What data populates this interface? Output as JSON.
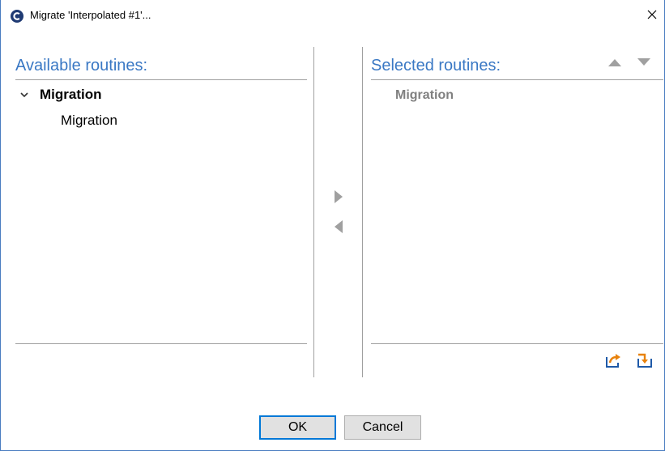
{
  "window": {
    "title": "Migrate 'Interpolated #1'..."
  },
  "available": {
    "title": "Available routines:",
    "tree": {
      "parent_label": "Migration",
      "child_label": "Migration"
    }
  },
  "selected": {
    "title": "Selected routines:",
    "items": [
      "Migration"
    ]
  },
  "buttons": {
    "ok_label": "OK",
    "cancel_label": "Cancel"
  },
  "colors": {
    "accent": "#3a78c4",
    "arrow_gray": "#a0a0a0",
    "orange_icon": "#e8820c"
  },
  "icons": {
    "app": "app-logo-icon",
    "close": "close-icon",
    "move_right": "triangle-right-icon",
    "move_left": "triangle-left-icon",
    "move_up": "triangle-up-icon",
    "move_down": "triangle-down-icon",
    "export": "export-icon",
    "import": "import-icon"
  }
}
